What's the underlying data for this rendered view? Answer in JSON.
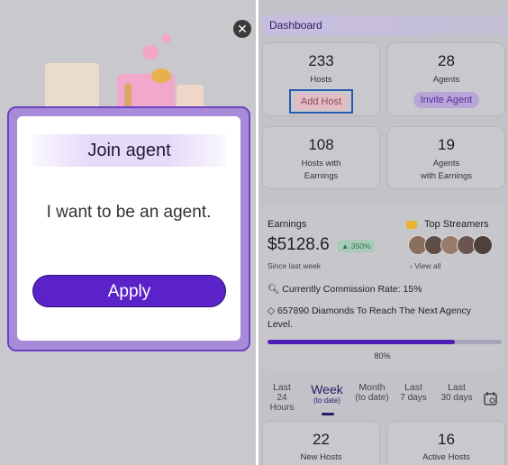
{
  "modal": {
    "title": "Join agent",
    "text": "I want to be an agent.",
    "apply_label": "Apply",
    "close_glyph": "✕"
  },
  "dashboard": {
    "title": "Dashboard",
    "hosts": {
      "num": "233",
      "label": "Hosts",
      "button": "Add Host"
    },
    "agents": {
      "num": "28",
      "label": "Agents",
      "button": "Invite Agent"
    },
    "hosts_earn": {
      "num": "108",
      "line1": "Hosts with",
      "line2": "Earnings"
    },
    "agents_earn": {
      "num": "19",
      "line1": "Agents",
      "line2": "with Earnings"
    }
  },
  "earnings": {
    "title": "Earnings",
    "amount": "$5128.6",
    "change": "▲ 350%",
    "since": "Since last week",
    "top_streamers": "Top Streamers",
    "view_all": "› View all",
    "commission": "Currently Commission Rate: 15%",
    "diamonds": "657890 Diamonds To Reach The Next Agency Level.",
    "progress": 0.8,
    "progress_label": "80%"
  },
  "tabs": [
    {
      "line1": "Last",
      "line2": "24 Hours"
    },
    {
      "line1": "Week",
      "line2": "(to date)",
      "active": true
    },
    {
      "line1": "Month",
      "line2": "(to date)"
    },
    {
      "line1": "Last",
      "line2": "7 days"
    },
    {
      "line1": "Last",
      "line2": "30 days"
    }
  ],
  "bottom": {
    "new_hosts": {
      "num": "22",
      "label": "New Hosts"
    },
    "active_hosts": {
      "num": "16",
      "label": "Active Hosts"
    }
  },
  "colors": {
    "accent": "#5a22c8",
    "progress_fill": "#4e1eb8",
    "focus_ring": "#2b59b0"
  },
  "icons": [
    "close-icon",
    "gift-decoration",
    "crown-icon",
    "search-icon",
    "diamond-icon",
    "calendar-icon"
  ]
}
